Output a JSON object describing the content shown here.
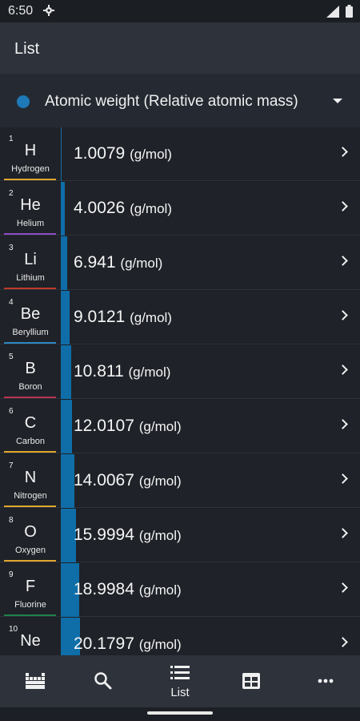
{
  "status": {
    "time": "6:50",
    "icons": [
      "gear-icon",
      "signal-icon",
      "battery-icon"
    ]
  },
  "app_bar": {
    "title": "List"
  },
  "selector": {
    "label": "Atomic weight (Relative atomic mass)",
    "dot_color": "#1e79b7"
  },
  "accent_color": "#0f6ea8",
  "elements": [
    {
      "number": "1",
      "symbol": "H",
      "name": "Hydrogen",
      "value": "1.0079",
      "unit": "(g/mol)",
      "group_color": "#e0a62d",
      "weight": 1.0079
    },
    {
      "number": "2",
      "symbol": "He",
      "name": "Helium",
      "value": "4.0026",
      "unit": "(g/mol)",
      "group_color": "#8e4bc4",
      "weight": 4.0026
    },
    {
      "number": "3",
      "symbol": "Li",
      "name": "Lithium",
      "value": "6.941",
      "unit": "(g/mol)",
      "group_color": "#c0392b",
      "weight": 6.941
    },
    {
      "number": "4",
      "symbol": "Be",
      "name": "Beryllium",
      "value": "9.0121",
      "unit": "(g/mol)",
      "group_color": "#2e86c1",
      "weight": 9.0121
    },
    {
      "number": "5",
      "symbol": "B",
      "name": "Boron",
      "value": "10.811",
      "unit": "(g/mol)",
      "group_color": "#b83250",
      "weight": 10.811
    },
    {
      "number": "6",
      "symbol": "C",
      "name": "Carbon",
      "value": "12.0107",
      "unit": "(g/mol)",
      "group_color": "#e0a62d",
      "weight": 12.0107
    },
    {
      "number": "7",
      "symbol": "N",
      "name": "Nitrogen",
      "value": "14.0067",
      "unit": "(g/mol)",
      "group_color": "#e0a62d",
      "weight": 14.0067
    },
    {
      "number": "8",
      "symbol": "O",
      "name": "Oxygen",
      "value": "15.9994",
      "unit": "(g/mol)",
      "group_color": "#e0a62d",
      "weight": 15.9994
    },
    {
      "number": "9",
      "symbol": "F",
      "name": "Fluorine",
      "value": "18.9984",
      "unit": "(g/mol)",
      "group_color": "#1e8449",
      "weight": 18.9984
    },
    {
      "number": "10",
      "symbol": "Ne",
      "name": "",
      "value": "20.1797",
      "unit": "(g/mol)",
      "group_color": "#8e4bc4",
      "weight": 20.1797
    }
  ],
  "bottom_nav": [
    {
      "icon": "periodic-table-icon",
      "label": ""
    },
    {
      "icon": "search-icon",
      "label": ""
    },
    {
      "icon": "list-icon",
      "label": "List"
    },
    {
      "icon": "table-icon",
      "label": ""
    },
    {
      "icon": "more-icon",
      "label": ""
    }
  ]
}
